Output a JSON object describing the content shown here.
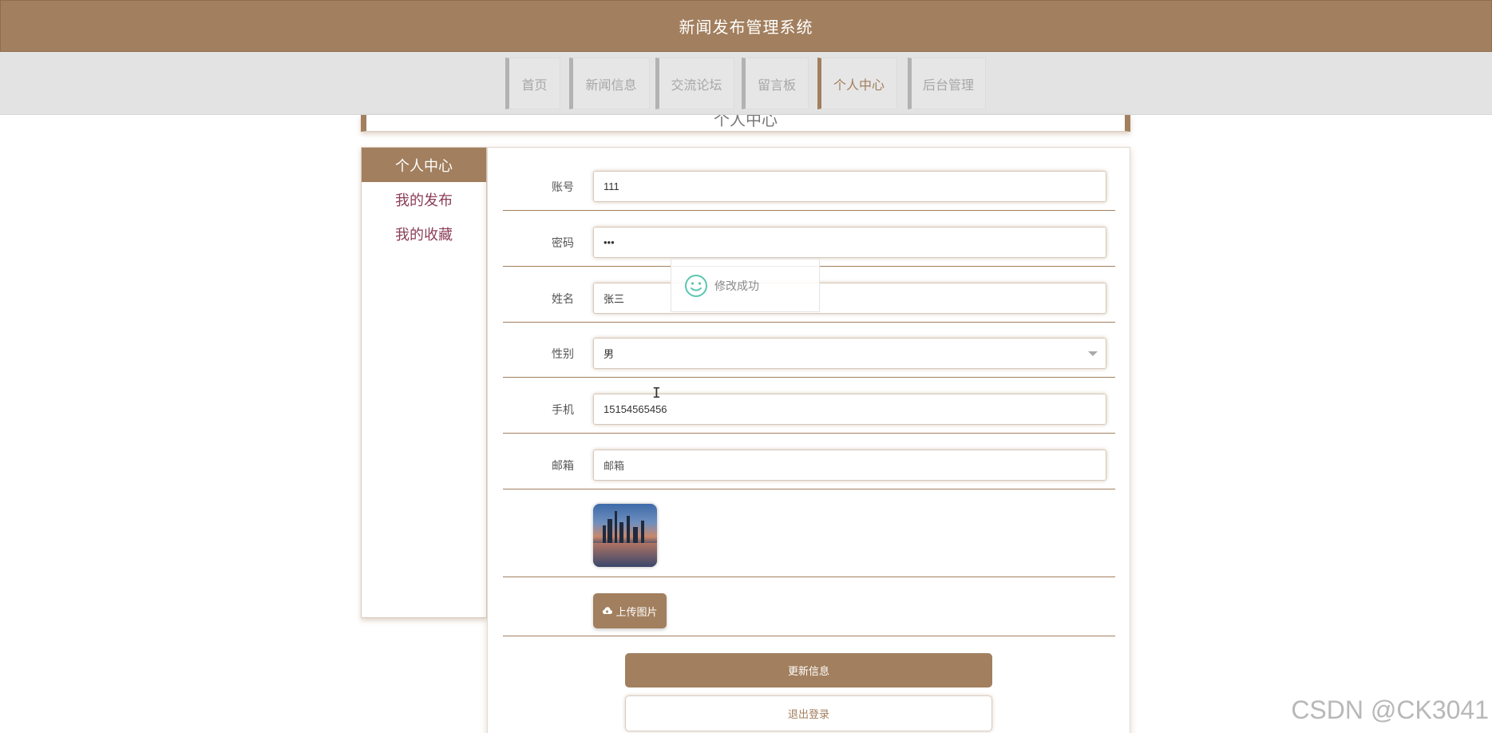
{
  "header": {
    "title": "新闻发布管理系统"
  },
  "nav": {
    "items": [
      {
        "label": "首页"
      },
      {
        "label": "新闻信息"
      },
      {
        "label": "交流论坛"
      },
      {
        "label": "留言板"
      },
      {
        "label": "个人中心",
        "active": true
      },
      {
        "label": "后台管理"
      }
    ]
  },
  "page": {
    "title": "个人中心"
  },
  "sidebar": {
    "items": [
      {
        "label": "个人中心",
        "active": true
      },
      {
        "label": "我的发布"
      },
      {
        "label": "我的收藏"
      }
    ]
  },
  "form": {
    "account": {
      "label": "账号",
      "value": "111"
    },
    "password": {
      "label": "密码",
      "value": "•••"
    },
    "name": {
      "label": "姓名",
      "value": "张三"
    },
    "gender": {
      "label": "性别",
      "value": "男"
    },
    "phone": {
      "label": "手机",
      "value": "15154565456"
    },
    "email": {
      "label": "邮箱",
      "value": "邮箱"
    },
    "upload_label": "上传图片",
    "update_label": "更新信息",
    "logout_label": "退出登录"
  },
  "toast": {
    "message": "修改成功"
  },
  "watermark": "CSDN @CK3041",
  "colors": {
    "brand": "#a27f5e",
    "sidebar_link": "#8b3d58",
    "toast_icon": "#5bc7b0"
  }
}
